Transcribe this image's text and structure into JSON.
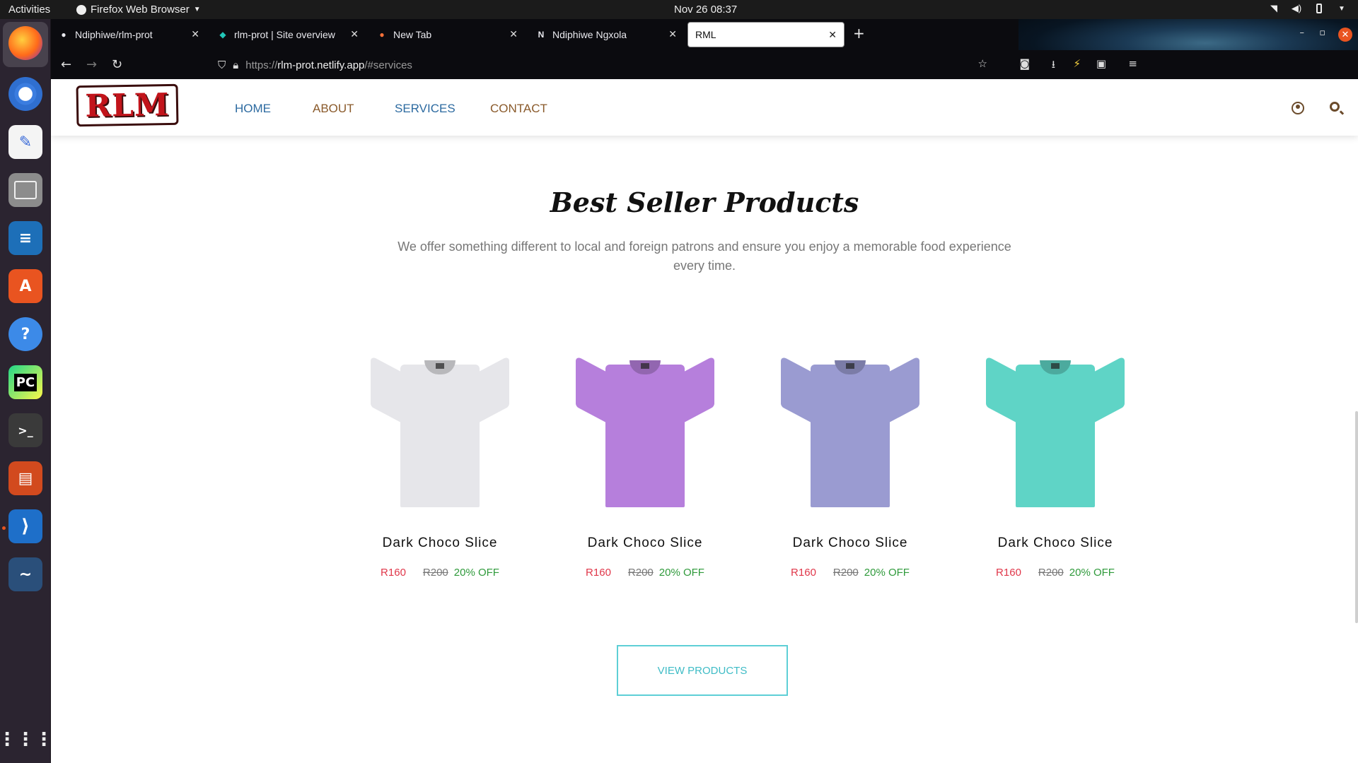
{
  "topbar": {
    "activities": "Activities",
    "app_name": "Firefox Web Browser",
    "clock": "Nov 26  08:37"
  },
  "dock": {
    "items": [
      "Firefox",
      "Chromium",
      "Text Editor",
      "Files",
      "LibreOffice Writer",
      "Ubuntu Software",
      "Help",
      "PyCharm",
      "Terminal",
      "LibreOffice Impress",
      "Visual Studio Code",
      "MySQL Workbench"
    ],
    "show_apps": "Show Applications"
  },
  "tabs": [
    {
      "title": "Ndiphiwe/rlm-prot",
      "icon": "github-icon"
    },
    {
      "title": "rlm-prot | Site overview",
      "icon": "netlify-icon"
    },
    {
      "title": "New Tab",
      "icon": "firefox-icon"
    },
    {
      "title": "Ndiphiwe Ngxola",
      "icon": "n-logo-icon"
    },
    {
      "title": "RML",
      "icon": "",
      "active": true
    }
  ],
  "url": {
    "scheme": "https://",
    "host": "rlm-prot.netlify.app",
    "path": "/#services"
  },
  "site": {
    "logo_text": "RLM",
    "nav": {
      "home": "HOME",
      "about": "ABOUT",
      "services": "SERVICES",
      "contact": "CONTACT"
    },
    "section_title": "Best Seller Products",
    "section_subtitle": "We offer something different to local and foreign patrons and ensure you enjoy a memorable food experience every time.",
    "products": [
      {
        "name": "Dark Choco Slice",
        "price": "R160",
        "old_price": "R200",
        "discount": "20% OFF",
        "color": "#e6e6ea"
      },
      {
        "name": "Dark Choco Slice",
        "price": "R160",
        "old_price": "R200",
        "discount": "20% OFF",
        "color": "#b67fdc"
      },
      {
        "name": "Dark Choco Slice",
        "price": "R160",
        "old_price": "R200",
        "discount": "20% OFF",
        "color": "#9a9bd1"
      },
      {
        "name": "Dark Choco Slice",
        "price": "R160",
        "old_price": "R200",
        "discount": "20% OFF",
        "color": "#5fd4c6"
      }
    ],
    "view_button": "VIEW PRODUCTS"
  }
}
